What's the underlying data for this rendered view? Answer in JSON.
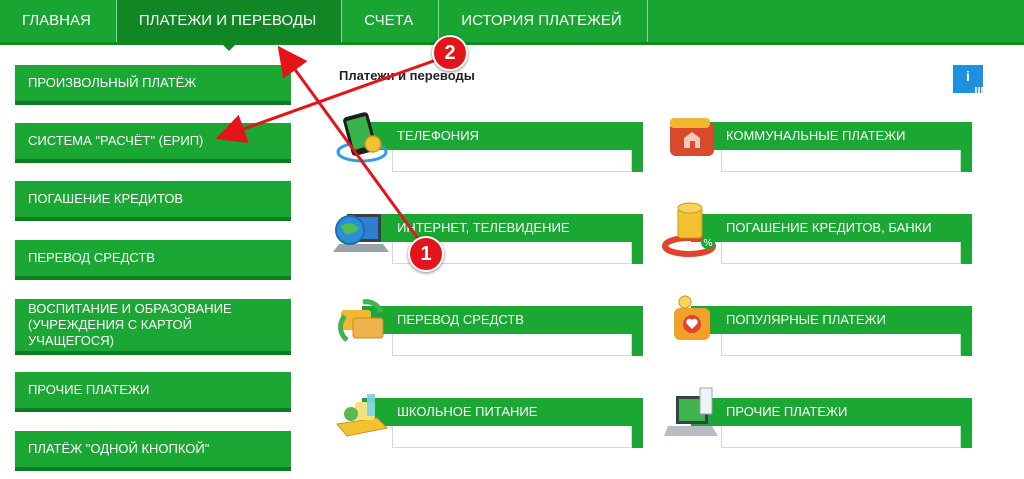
{
  "nav": {
    "tabs": [
      {
        "label": "ГЛАВНАЯ"
      },
      {
        "label": "ПЛАТЕЖИ И ПЕРЕВОДЫ"
      },
      {
        "label": "СЧЕТА"
      },
      {
        "label": "ИСТОРИЯ ПЛАТЕЖЕЙ"
      }
    ]
  },
  "sidebar": {
    "items": [
      {
        "label": "ПРОИЗВОЛЬНЫЙ ПЛАТЁЖ"
      },
      {
        "label": "СИСТЕМА \"РАСЧЁТ\" (ЕРИП)"
      },
      {
        "label": "ПОГАШЕНИЕ КРЕДИТОВ"
      },
      {
        "label": "ПЕРЕВОД СРЕДСТВ"
      },
      {
        "label": "ВОСПИТАНИЕ И ОБРАЗОВАНИЕ (УЧРЕЖДЕНИЯ С КАРТОЙ УЧАЩЕГОСЯ)"
      },
      {
        "label": "ПРОЧИЕ ПЛАТЕЖИ"
      },
      {
        "label": "ПЛАТЁЖ \"ОДНОЙ КНОПКОЙ\""
      }
    ]
  },
  "main": {
    "title": "Платежи и переводы",
    "info_label": "i",
    "tiles": [
      {
        "label": "ТЕЛЕФОНИЯ",
        "icon": "phone-icon"
      },
      {
        "label": "КОММУНАЛЬНЫЕ ПЛАТЕЖИ",
        "icon": "wallet-house-icon"
      },
      {
        "label": "ИНТЕРНЕТ, ТЕЛЕВИДЕНИЕ",
        "icon": "globe-laptop-icon"
      },
      {
        "label": "ПОГАШЕНИЕ КРЕДИТОВ, БАНКИ",
        "icon": "coins-lifebuoy-icon"
      },
      {
        "label": "ПЕРЕВОД СРЕДСТВ",
        "icon": "transfer-cards-icon"
      },
      {
        "label": "ПОПУЛЯРНЫЕ ПЛАТЕЖИ",
        "icon": "heart-wallet-icon"
      },
      {
        "label": "ШКОЛЬНОЕ ПИТАНИЕ",
        "icon": "school-meal-icon"
      },
      {
        "label": "ПРОЧИЕ ПЛАТЕЖИ",
        "icon": "laptop-receipt-icon"
      }
    ]
  },
  "annotations": {
    "badge1": "1",
    "badge2": "2",
    "color": "#e3151a"
  },
  "colors": {
    "brand_green": "#19a531",
    "dark_green": "#0d7d22",
    "info_blue": "#1f8fe0"
  }
}
